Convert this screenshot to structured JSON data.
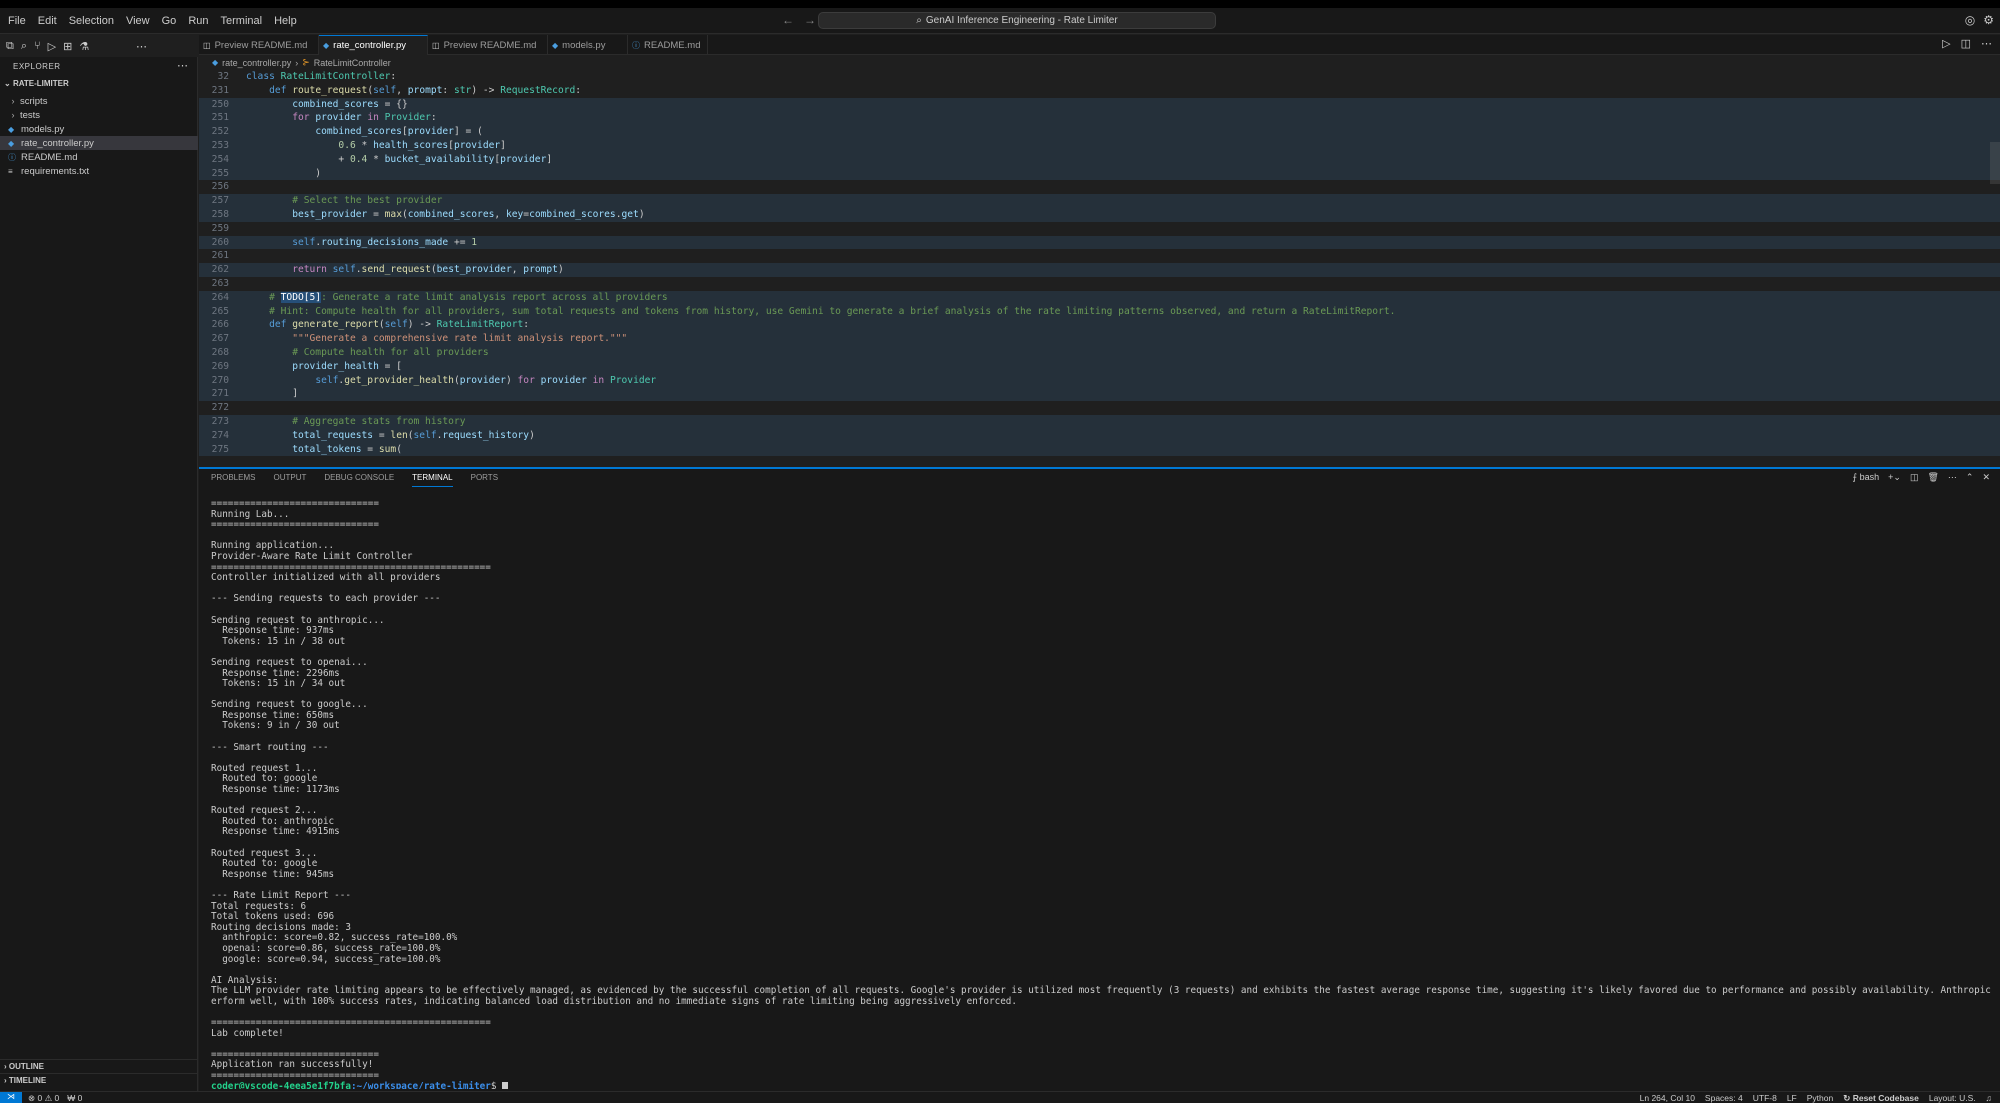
{
  "menu": [
    "File",
    "Edit",
    "Selection",
    "View",
    "Go",
    "Run",
    "Terminal",
    "Help"
  ],
  "title": "GenAI Inference Engineering - Rate Limiter",
  "explorer": {
    "title": "EXPLORER",
    "root": "RATE-LIMITER",
    "items": [
      {
        "label": "scripts",
        "kind": "folder",
        "icon": "chevron-right"
      },
      {
        "label": "tests",
        "kind": "folder",
        "icon": "chevron-right"
      },
      {
        "label": "models.py",
        "kind": "file",
        "icon": "python"
      },
      {
        "label": "rate_controller.py",
        "kind": "file",
        "icon": "python"
      },
      {
        "label": "README.md",
        "kind": "file",
        "icon": "info"
      },
      {
        "label": "requirements.txt",
        "kind": "file",
        "icon": "lines"
      }
    ]
  },
  "outline": "OUTLINE",
  "timeline": "TIMELINE",
  "tabs": [
    {
      "label": "Preview README.md"
    },
    {
      "label": "rate_controller.py"
    },
    {
      "label": "Preview README.md"
    },
    {
      "label": "models.py"
    },
    {
      "label": "README.md"
    }
  ],
  "breadcrumb": {
    "file": "rate_controller.py",
    "symbol": "RateLimitController"
  },
  "code": [
    {
      "n": "32",
      "t": "class RateLimitController:"
    },
    {
      "n": "231",
      "t": "    def route_request(self, prompt: str) -> RequestRecord:"
    },
    {
      "n": "250",
      "t": "        combined_scores = {}"
    },
    {
      "n": "251",
      "t": "        for provider in Provider:"
    },
    {
      "n": "252",
      "t": "            combined_scores[provider] = ("
    },
    {
      "n": "253",
      "t": "                0.6 * health_scores[provider]"
    },
    {
      "n": "254",
      "t": "                + 0.4 * bucket_availability[provider]"
    },
    {
      "n": "255",
      "t": "            )"
    },
    {
      "n": "256",
      "t": ""
    },
    {
      "n": "257",
      "t": "        # Select the best provider"
    },
    {
      "n": "258",
      "t": "        best_provider = max(combined_scores, key=combined_scores.get)"
    },
    {
      "n": "259",
      "t": ""
    },
    {
      "n": "260",
      "t": "        self.routing_decisions_made += 1"
    },
    {
      "n": "261",
      "t": ""
    },
    {
      "n": "262",
      "t": "        return self.send_request(best_provider, prompt)"
    },
    {
      "n": "263",
      "t": ""
    },
    {
      "n": "264",
      "t": "    # TODO[5]: Generate a rate limit analysis report across all providers"
    },
    {
      "n": "265",
      "t": "    # Hint: Compute health for all providers, sum total requests and tokens from history, use Gemini to generate a brief analysis of the rate limiting patterns observed, and return a RateLimitReport."
    },
    {
      "n": "266",
      "t": "    def generate_report(self) -> RateLimitReport:"
    },
    {
      "n": "267",
      "t": "        \"\"\"Generate a comprehensive rate limit analysis report.\"\"\""
    },
    {
      "n": "268",
      "t": "        # Compute health for all providers"
    },
    {
      "n": "269",
      "t": "        provider_health = ["
    },
    {
      "n": "270",
      "t": "            self.get_provider_health(provider) for provider in Provider"
    },
    {
      "n": "271",
      "t": "        ]"
    },
    {
      "n": "272",
      "t": ""
    },
    {
      "n": "273",
      "t": "        # Aggregate stats from history"
    },
    {
      "n": "274",
      "t": "        total_requests = len(self.request_history)"
    },
    {
      "n": "275",
      "t": "        total_tokens = sum("
    }
  ],
  "panel_tabs": [
    "PROBLEMS",
    "OUTPUT",
    "DEBUG CONSOLE",
    "TERMINAL",
    "PORTS"
  ],
  "terminal_name": "bash",
  "terminal": [
    "==============================",
    "Running Lab...",
    "==============================",
    "",
    "Running application...",
    "Provider-Aware Rate Limit Controller",
    "==================================================",
    "Controller initialized with all providers",
    "",
    "--- Sending requests to each provider ---",
    "",
    "Sending request to anthropic...",
    "  Response time: 937ms",
    "  Tokens: 15 in / 38 out",
    "",
    "Sending request to openai...",
    "  Response time: 2296ms",
    "  Tokens: 15 in / 34 out",
    "",
    "Sending request to google...",
    "  Response time: 650ms",
    "  Tokens: 9 in / 30 out",
    "",
    "--- Smart routing ---",
    "",
    "Routed request 1...",
    "  Routed to: google",
    "  Response time: 1173ms",
    "",
    "Routed request 2...",
    "  Routed to: anthropic",
    "  Response time: 4915ms",
    "",
    "Routed request 3...",
    "  Routed to: google",
    "  Response time: 945ms",
    "",
    "--- Rate Limit Report ---",
    "Total requests: 6",
    "Total tokens used: 696",
    "Routing decisions made: 3",
    "  anthropic: score=0.82, success_rate=100.0%",
    "  openai: score=0.86, success_rate=100.0%",
    "  google: score=0.94, success_rate=100.0%",
    "",
    "AI Analysis:",
    "The LLM provider rate limiting appears to be effectively managed, as evidenced by the successful completion of all requests. Google's provider is utilized most frequently (3 requests) and exhibits the fastest average response time, suggesting it's likely favored due to performance and possibly availability. Anthropic and OpenAI also p",
    "erform well, with 100% success rates, indicating balanced load distribution and no immediate signs of rate limiting being aggressively enforced.",
    "",
    "==================================================",
    "Lab complete!",
    "",
    "==============================",
    "Application ran successfully!",
    "=============================="
  ],
  "prompt": {
    "user": "coder@vscode-4eea5e1f7bfa",
    "path": ":~/workspace/rate-limiter",
    "symbol": "$ "
  },
  "status": {
    "problems": "⊗ 0 ⚠ 0",
    "ports": "₩ 0",
    "position": "Ln 264, Col 10",
    "spaces": "Spaces: 4",
    "encoding": "UTF-8",
    "eol": "LF",
    "language": "Python",
    "reset": "Reset Codebase",
    "layout": "Layout: U.S."
  }
}
